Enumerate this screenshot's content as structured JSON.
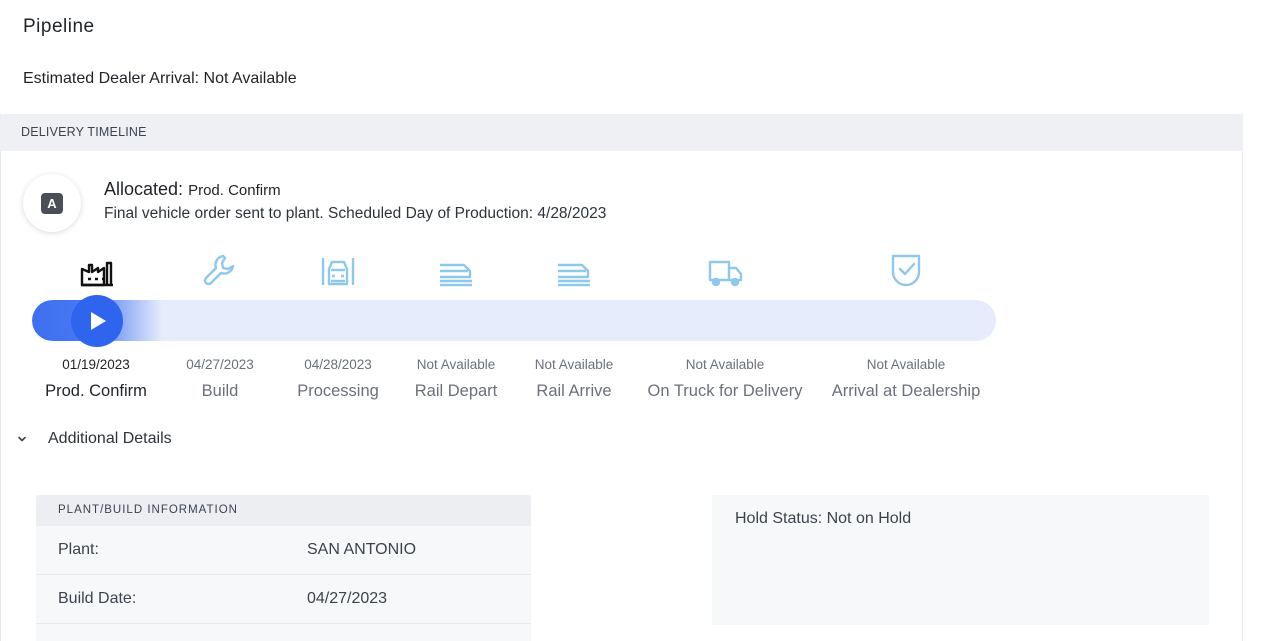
{
  "page": {
    "title": "Pipeline",
    "eta_label": "Estimated Dealer Arrival: Not Available"
  },
  "timeline": {
    "header": "DELIVERY TIMELINE",
    "status": {
      "badge": "A",
      "title": "Allocated:",
      "subtitle": "Prod. Confirm",
      "description": "Final vehicle order sent to plant. Scheduled Day of Production: 4/28/2023"
    },
    "progress": {
      "current_step_index": 0,
      "fill_fraction": 0.07
    },
    "steps": [
      {
        "date": "01/19/2023",
        "label": "Prod. Confirm",
        "icon": "factory-icon",
        "active": true
      },
      {
        "date": "04/27/2023",
        "label": "Build",
        "icon": "wrench-icon",
        "active": false
      },
      {
        "date": "04/28/2023",
        "label": "Processing",
        "icon": "car-front-icon",
        "active": false
      },
      {
        "date": "Not Available",
        "label": "Rail Depart",
        "icon": "rail-car-icon",
        "active": false
      },
      {
        "date": "Not Available",
        "label": "Rail Arrive",
        "icon": "rail-car-icon",
        "active": false
      },
      {
        "date": "Not Available",
        "label": "On Truck for Delivery",
        "icon": "truck-icon",
        "active": false
      },
      {
        "date": "Not Available",
        "label": "Arrival at Dealership",
        "icon": "shield-check-icon",
        "active": false
      }
    ],
    "colors": {
      "active_icon": "#111111",
      "inactive_icon": "#8ec8ea",
      "track": "#e6ecfb",
      "progress": "#2f64ef"
    }
  },
  "details": {
    "toggle_label": "Additional Details",
    "plant_card": {
      "header": "PLANT/BUILD INFORMATION",
      "rows": [
        {
          "key": "Plant:",
          "value": "SAN ANTONIO"
        },
        {
          "key": "Build Date:",
          "value": "04/27/2023"
        }
      ]
    },
    "hold_status": "Hold Status: Not on Hold"
  }
}
